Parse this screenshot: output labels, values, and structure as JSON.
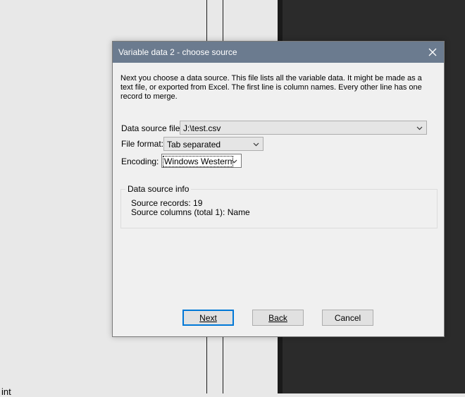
{
  "background": {
    "fragment_text": "int"
  },
  "dialog": {
    "title": "Variable data 2 - choose source",
    "intro": "Next you choose a data source. This file lists all the variable data. It might be made as a text file, or exported from Excel. The first line is column names. Every other line has one record to merge.",
    "data_source_file": {
      "label": "Data source file:",
      "value": "J:\\test.csv"
    },
    "file_format": {
      "label": "File format:",
      "value": "Tab separated"
    },
    "encoding": {
      "label": "Encoding:",
      "value": "Windows Western"
    },
    "info": {
      "title": "Data source info",
      "records": "Source records: 19",
      "columns": "Source columns (total 1): Name"
    },
    "buttons": {
      "next": "Next",
      "back": "Back",
      "cancel": "Cancel"
    },
    "colors": {
      "titlebar": "#6b7b8f",
      "focus": "#0078d7"
    }
  }
}
